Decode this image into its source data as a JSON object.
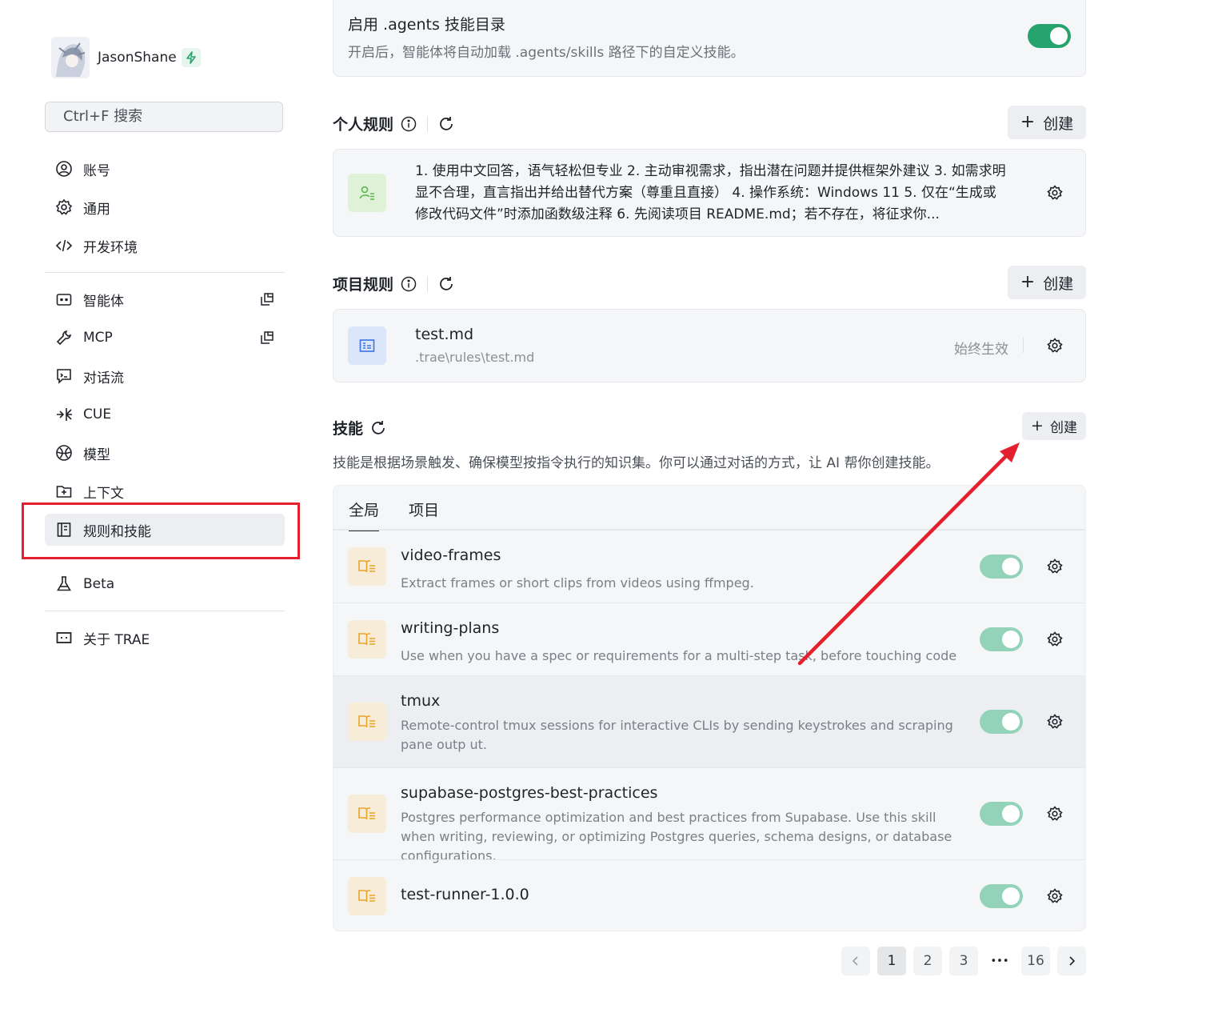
{
  "profile": {
    "username": "JasonShane"
  },
  "search": {
    "label": "Ctrl+F 搜索"
  },
  "nav": {
    "account": "账号",
    "general": "通用",
    "devenv": "开发环境",
    "agents": "智能体",
    "mcp": "MCP",
    "flow": "对话流",
    "cue": "CUE",
    "model": "模型",
    "context": "上下文",
    "rules": "规则和技能",
    "beta": "Beta",
    "about": "关于 TRAE"
  },
  "agents_dir": {
    "title": "启用 .agents 技能目录",
    "desc": "开启后，智能体将自动加载 .agents/skills 路径下的自定义技能。",
    "enabled": true
  },
  "personal_rules": {
    "title": "个人规则",
    "create": "创建",
    "text": "1. 使用中文回答，语气轻松但专业 2. 主动审视需求，指出潜在问题并提供框架外建议 3. 如需求明显不合理，直言指出并给出替代方案（尊重且直接） 4. 操作系统：Windows 11 5. 仅在“生成或修改代码文件”时添加函数级注释 6. 先阅读项目 README.md；若不存在，将征求你..."
  },
  "project_rules": {
    "title": "项目规则",
    "create": "创建",
    "file": {
      "name": "test.md",
      "path": ".trae\\rules\\test.md",
      "status": "始终生效"
    }
  },
  "skills": {
    "title": "技能",
    "create": "创建",
    "desc": "技能是根据场景触发、确保模型按指令执行的知识集。你可以通过对话的方式，让 AI 帮你创建技能。",
    "tabs": [
      "全局",
      "项目"
    ],
    "items": [
      {
        "name": "video-frames",
        "desc": "Extract frames or short clips from videos using ffmpeg."
      },
      {
        "name": "writing-plans",
        "desc": "Use when you have a spec or requirements for a multi-step task, before touching code"
      },
      {
        "name": "tmux",
        "desc": "Remote-control tmux sessions for interactive CLIs by sending keystrokes and scraping pane outp ut."
      },
      {
        "name": "supabase-postgres-best-practices",
        "desc": "Postgres performance optimization and best practices from Supabase. Use this skill when writing, reviewing, or optimizing Postgres queries, schema designs, or database configurations."
      },
      {
        "name": "test-runner-1.0.0",
        "desc": ""
      }
    ]
  },
  "pagination": {
    "pages": [
      "1",
      "2",
      "3",
      "16"
    ],
    "ellipsis": "•••",
    "current": "1"
  },
  "colors": {
    "accent_green": "#27a36d",
    "annotation_red": "#e5202e"
  }
}
